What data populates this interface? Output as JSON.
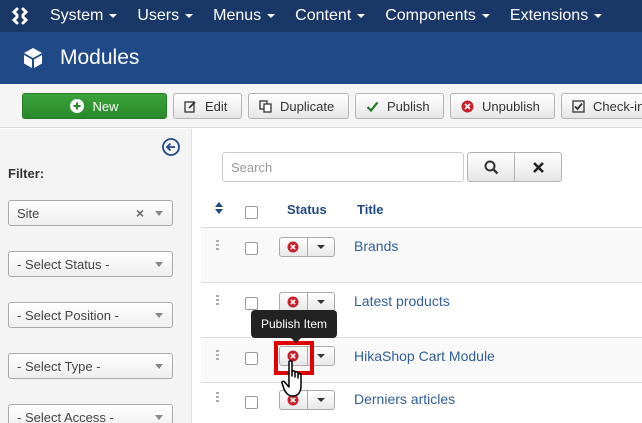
{
  "topnav": {
    "items": [
      "System",
      "Users",
      "Menus",
      "Content",
      "Components",
      "Extensions"
    ]
  },
  "header": {
    "title": "Modules"
  },
  "toolbar": {
    "new": "New",
    "edit": "Edit",
    "duplicate": "Duplicate",
    "publish": "Publish",
    "unpublish": "Unpublish",
    "checkin": "Check-in"
  },
  "sidebar": {
    "filter_label": "Filter:",
    "selects": [
      "Site",
      "- Select Status -",
      "- Select Position -",
      "- Select Type -",
      "- Select Access -"
    ]
  },
  "search": {
    "placeholder": "Search"
  },
  "table": {
    "headers": {
      "status": "Status",
      "title": "Title"
    },
    "rows": [
      "Brands",
      "Latest products",
      "HikaShop Cart Module",
      "Derniers articles"
    ]
  },
  "tooltip": {
    "text": "Publish Item"
  },
  "colors": {
    "topnav": "#1a3867",
    "header": "#1f4a87",
    "new_button": "#2a8a2a",
    "link": "#2f5f99",
    "highlight": "#e00000",
    "unpublished": "#c8202a"
  }
}
